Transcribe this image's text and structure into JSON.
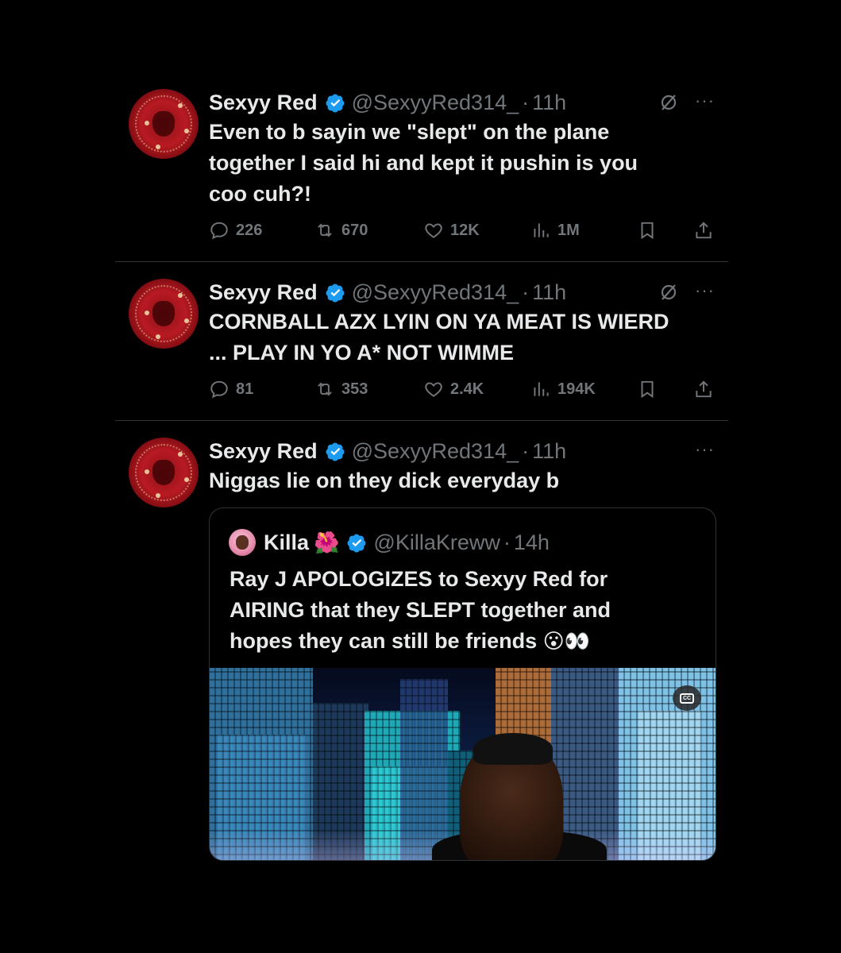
{
  "tweets": [
    {
      "name": "Sexyy Red",
      "handle": "@SexyyRed314_",
      "sep": "·",
      "time": "11h",
      "lines": [
        "Even to b sayin we \"slept\" on the plane",
        "together I said hi and kept it pushin is you",
        "coo cuh?!"
      ],
      "replies": "226",
      "reposts": "670",
      "likes": "12K",
      "views": "1M"
    },
    {
      "name": "Sexyy Red",
      "handle": "@SexyyRed314_",
      "sep": "·",
      "time": "11h",
      "lines": [
        "CORNBALL AZX LYIN ON YA MEAT IS WIERD",
        "... PLAY IN YO A* NOT WIMME"
      ],
      "replies": "81",
      "reposts": "353",
      "likes": "2.4K",
      "views": "194K"
    },
    {
      "name": "Sexyy Red",
      "handle": "@SexyyRed314_",
      "sep": "·",
      "time": "11h",
      "lines": [
        "Niggas lie on they dick everyday b"
      ]
    }
  ],
  "quote": {
    "name": "Killa",
    "flower": "🌺",
    "handle": "@KillaKreww",
    "sep": "·",
    "time": "14h",
    "lines": [
      "Ray J APOLOGIZES to Sexyy Red for",
      "AIRING that they SLEPT together and",
      "hopes they can still be friends"
    ],
    "emojis": "😮👀",
    "cc_label": "CC"
  },
  "colors": {
    "background": "#000000",
    "text": "#e7e9ea",
    "muted": "#71767b",
    "verified": "#1d9bf0",
    "divider": "#2f3336"
  }
}
